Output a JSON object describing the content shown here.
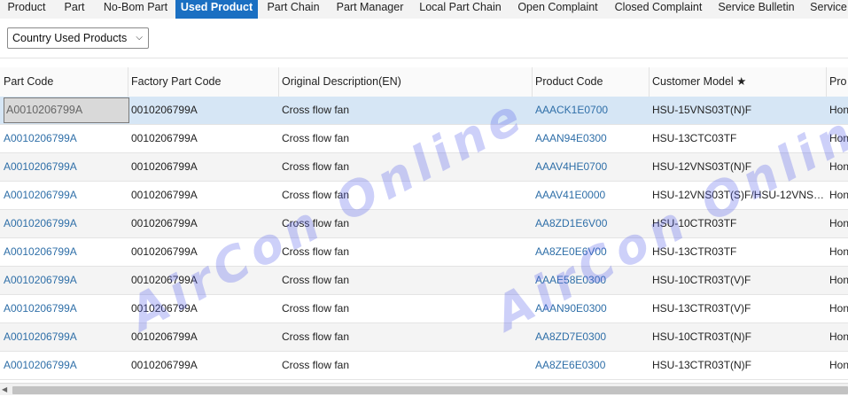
{
  "tabs": [
    {
      "label": "Product",
      "active": false
    },
    {
      "label": "Part",
      "active": false
    },
    {
      "label": "No-Bom Part",
      "active": false
    },
    {
      "label": "Used Product",
      "active": true
    },
    {
      "label": "Part Chain",
      "active": false
    },
    {
      "label": "Part Manager",
      "active": false
    },
    {
      "label": "Local Part Chain",
      "active": false
    },
    {
      "label": "Open Complaint",
      "active": false
    },
    {
      "label": "Closed Complaint",
      "active": false
    },
    {
      "label": "Service Bulletin",
      "active": false
    },
    {
      "label": "Service",
      "active": false
    }
  ],
  "filter": {
    "selected": "Country Used Products"
  },
  "columns": [
    "Part Code",
    "Factory Part Code",
    "Original Description(EN)",
    "Product Code",
    "Customer Model ★",
    "Pro"
  ],
  "rows": [
    [
      "A0010206799A",
      "0010206799A",
      "Cross flow fan",
      "AAACK1E0700",
      "HSU-15VNS03T(N)F",
      "Hon"
    ],
    [
      "A0010206799A",
      "0010206799A",
      "Cross flow fan",
      "AAAN94E0300",
      "HSU-13CTC03TF",
      "Hon"
    ],
    [
      "A0010206799A",
      "0010206799A",
      "Cross flow fan",
      "AAAV4HE0700",
      "HSU-12VNS03T(N)F",
      "Hon"
    ],
    [
      "A0010206799A",
      "0010206799A",
      "Cross flow fan",
      "AAAV41E0000",
      "HSU-12VNS03T(S)F/HSU-12VNS0...",
      "Hon"
    ],
    [
      "A0010206799A",
      "0010206799A",
      "Cross flow fan",
      "AA8ZD1E6V00",
      "HSU-10CTR03TF",
      "Hon"
    ],
    [
      "A0010206799A",
      "0010206799A",
      "Cross flow fan",
      "AA8ZE0E6V00",
      "HSU-13CTR03TF",
      "Hon"
    ],
    [
      "A0010206799A",
      "0010206799A",
      "Cross flow fan",
      "AAAE58E0300",
      "HSU-10CTR03T(V)F",
      "Hon"
    ],
    [
      "A0010206799A",
      "0010206799A",
      "Cross flow fan",
      "AAAN90E0300",
      "HSU-13CTR03T(V)F",
      "Hon"
    ],
    [
      "A0010206799A",
      "0010206799A",
      "Cross flow fan",
      "AA8ZD7E0300",
      "HSU-10CTR03T(N)F",
      "Hon"
    ],
    [
      "A0010206799A",
      "0010206799A",
      "Cross flow fan",
      "AA8ZE6E0300",
      "HSU-13CTR03T(N)F",
      "Hon"
    ]
  ],
  "watermark": "AirCon Online"
}
